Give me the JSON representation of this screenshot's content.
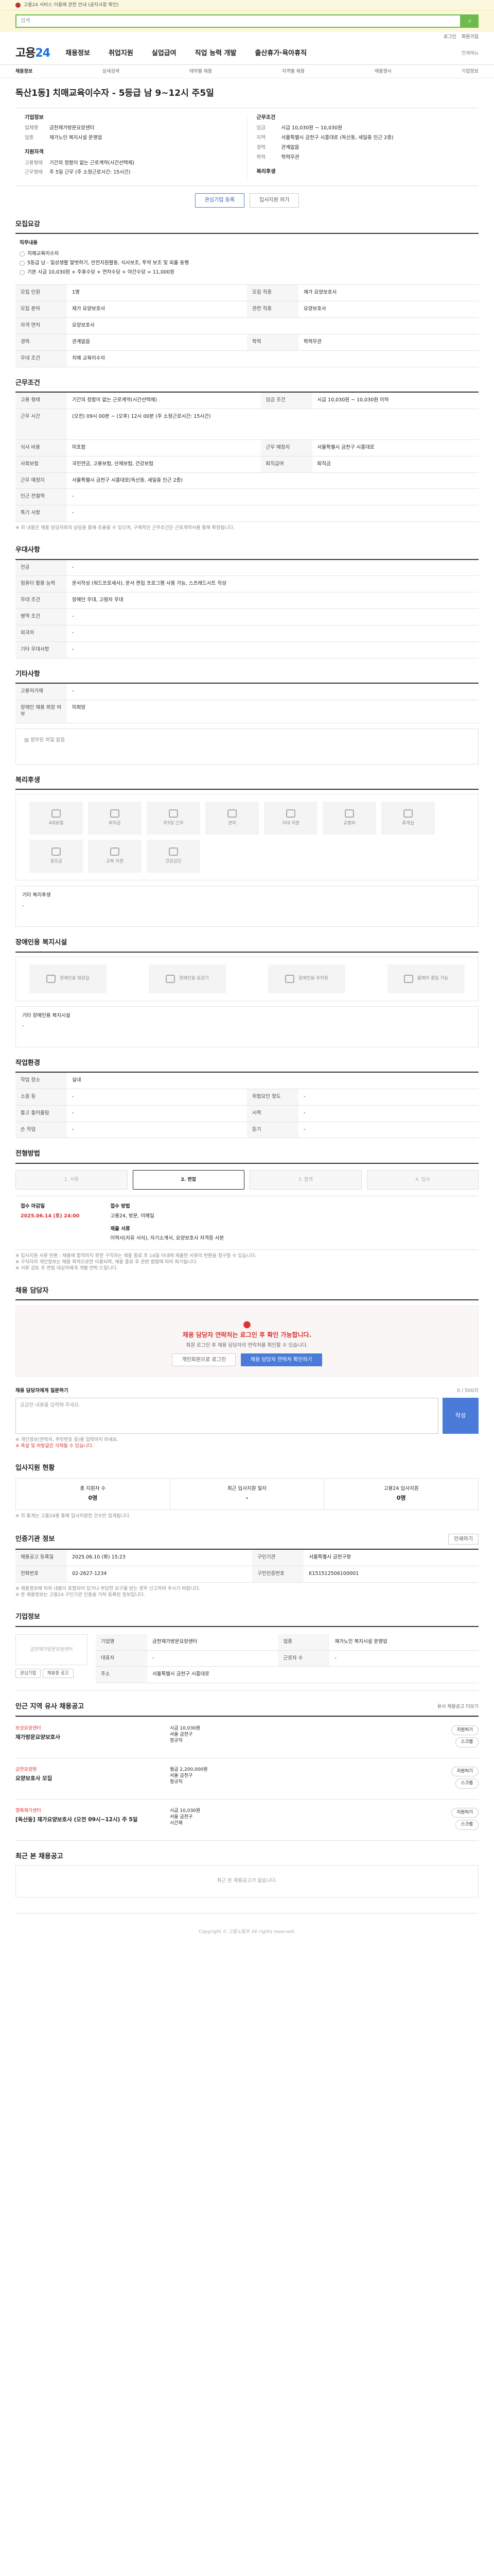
{
  "topbar": {
    "notice": "고용24 서비스 이용에 관한 안내 (공지사항 확인)"
  },
  "search": {
    "placeholder": "검색"
  },
  "util": {
    "login": "로그인",
    "join": "회원가입"
  },
  "gnb": {
    "logo_a": "고용",
    "logo_b": "24",
    "menus": [
      "채용정보",
      "취업지원",
      "실업급여",
      "직업 능력 개발",
      "출산휴가·육아휴직"
    ],
    "right": "전체메뉴"
  },
  "subnav": [
    "채용정보",
    "상세검색",
    "테마별 채용",
    "지역별 채용",
    "채용행사",
    "기업정보"
  ],
  "job": {
    "title": "독산1동] 치매교육이수자 - 5등급 남 9~12시 주5일",
    "company_h": "기업정보",
    "company_rows": [
      {
        "k": "업체명",
        "v": "금천재가방문요양센터"
      },
      {
        "k": "업종",
        "v": "재가노인 복지시설 운영업"
      }
    ],
    "cond_h": "근무조건",
    "cond_rows": [
      {
        "k": "임금",
        "v": "시급 10,030원 ~ 10,030원"
      },
      {
        "k": "지역",
        "v": "서울특별시 금천구 시흥대로 (독산동, 세일중 인근 2층)"
      },
      {
        "k": "경력",
        "v": "관계없음"
      },
      {
        "k": "학력",
        "v": "학력무관"
      }
    ],
    "qual_h": "지원자격",
    "qual_rows": [
      {
        "k": "고용형태",
        "v": "기간의 정함이 없는 근로계약(시간선택제)"
      },
      {
        "k": "근무형태",
        "v": "주 5일 근무 (주 소정근로시간: 15시간)"
      }
    ],
    "welfare_h": "복리후생",
    "btn_apply": "입사지원 하기",
    "btn_interest": "관심기업 등록",
    "btn_scrap": "스크랩"
  },
  "recruit": {
    "h": "모집요강",
    "sub": "직무내용",
    "lines": [
      "치매교육이수자",
      "5등급 남 - 일상생활 말벗하기, 안전지원활동, 식사보조, 투약 보조 및 외출 동행",
      "기본 시급 10,030원 + 주휴수당 + 연차수당 + 야간수당 = 11,000원"
    ],
    "rows": [
      {
        "k": "모집 인원",
        "v": "1명",
        "k2": "모집 직종",
        "v2": "재가 요양보호사"
      },
      {
        "k": "모집 분야",
        "v": "재가 요양보호사",
        "k2": "관련 직종",
        "v2": "요양보호사"
      },
      {
        "k": "자격 면허",
        "v": "요양보호사",
        "k2": "",
        "v2": ""
      },
      {
        "k": "경력",
        "v": "관계없음",
        "k2": "학력",
        "v2": "학력무관"
      },
      {
        "k": "우대 조건",
        "v": "치매 교육이수자",
        "k2": "",
        "v2": ""
      }
    ]
  },
  "work": {
    "h": "근무조건",
    "rows": [
      {
        "k": "고용 형태",
        "v": "기간의 정함이 없는 근로계약(시간선택제)",
        "k2": "임금 조건",
        "v2": "시급 10,030원 ~ 10,030원 이하"
      },
      {
        "k": "근무 시간",
        "v": "(오전) 09시 00분 ~ (오후) 12시 00분 (주 소정근로시간: 15시간)",
        "k2": "",
        "v2": ""
      },
      {
        "k": "식사 비용",
        "v": "미포함",
        "k2": "근무 예정지",
        "v2": "서울특별시 금천구 시흥대로"
      },
      {
        "k": "사회보험",
        "v": "국민연금, 고용보험, 산재보험, 건강보험",
        "k2": "퇴직급여",
        "v2": "퇴직금"
      },
      {
        "k": "근무 예정지",
        "v": "서울특별시 금천구 시흥대로(독산동, 세일중 인근 2층)",
        "k2": "",
        "v2": ""
      },
      {
        "k": "인근 전철역",
        "v": "-",
        "k2": "",
        "v2": ""
      },
      {
        "k": "특기 사항",
        "v": "-",
        "k2": "",
        "v2": ""
      }
    ],
    "note": "※ 위 내용은 채용 담당자와의 상담을 통해 조율될 수 있으며, 구체적인 근무조건은 근로계약서를 통해 확정됩니다."
  },
  "pref": {
    "h": "우대사항",
    "rows": [
      {
        "k": "전공",
        "v": "-"
      },
      {
        "k": "컴퓨터 활용 능력",
        "v": "문서작성 (워드프로세서), 문서 편집 프로그램 사용 가능, 스프레드시트 작성"
      },
      {
        "k": "우대 조건",
        "v": "장애인 우대, 고령자 우대"
      },
      {
        "k": "병역 조건",
        "v": "-"
      },
      {
        "k": "외국어",
        "v": "-"
      },
      {
        "k": "기타 우대사항",
        "v": "-"
      }
    ]
  },
  "other": {
    "h": "기타사항",
    "rows": [
      {
        "k": "고용허가제",
        "v": "-"
      },
      {
        "k": "장애인 채용 희망 여부",
        "v": "미희망"
      }
    ],
    "attach": "첨부된 파일 없음"
  },
  "benefits": {
    "h": "복리후생",
    "items": [
      "4대보험",
      "퇴직금",
      "주5일 근무",
      "연차",
      "식대 지원",
      "교통비",
      "휴게실",
      "경조금",
      "교육 지원",
      "건강검진"
    ],
    "etc_h": "기타 복리후생",
    "etc": "-"
  },
  "disabled": {
    "h": "장애인용 복지시설",
    "items": [
      "장애인용 화장실",
      "장애인용 승강기",
      "장애인용 주차장",
      "휠체어 출입 가능"
    ],
    "etc_h": "기타 장애인용 복지시설",
    "etc": "-"
  },
  "env": {
    "h": "작업환경",
    "rows": [
      {
        "k": "작업 장소",
        "v": "실내",
        "k2": "",
        "v2": ""
      },
      {
        "k": "소음 등",
        "v": "-",
        "k2": "위험요인 정도",
        "v2": "-"
      },
      {
        "k": "들고 들어올림",
        "v": "-",
        "k2": "시력",
        "v2": "-"
      },
      {
        "k": "손 작업",
        "v": "-",
        "k2": "듣기",
        "v2": "-"
      }
    ]
  },
  "select": {
    "h": "전형방법",
    "steps": [
      "1. 서류",
      "2. 면접",
      "3. 합격",
      "4. 입사"
    ],
    "rows": [
      {
        "k": "접수 마감일",
        "v": "2025.06.14 (토) 24:00"
      },
      {
        "k": "접수 방법",
        "v": "고용24, 방문, 이메일"
      },
      {
        "k": "제출 서류",
        "v": "이력서(자유 서식), 자기소개서, 요양보호사 자격증 사본"
      }
    ],
    "notes": [
      "※ 입사지원 서류 반환 : 채용에 합격하지 못한 구직자는 채용 종료 후 14일 이내에 제출한 서류의 반환을 청구할 수 있습니다.",
      "※ 구직자의 개인정보는 채용 목적으로만 이용되며, 채용 종료 후 관련 법령에 따라 파기됩니다.",
      "※ 서류 검토 후 면접 대상자에게 개별 연락 드립니다."
    ]
  },
  "contact": {
    "h": "채용 담당자",
    "big": "채용 담당자 연락처는 로그인 후 확인 가능합니다.",
    "desc": "회원 로그인 후 채용 담당자의 연락처를 확인할 수 있습니다.",
    "btn1": "개인회원으로 로그인",
    "btn2": "채용 담당자 연락처 확인하기"
  },
  "qna": {
    "h": "채용 담당자에게 질문하기",
    "count": "0 / 500자",
    "placeholder": "궁금한 내용을 입력해 주세요.",
    "btn": "작성",
    "notes": [
      "※ 개인정보(연락처, 주민번호 등)를 입력하지 마세요.",
      "※ 욕설 및 비방글은 삭제될 수 있습니다."
    ]
  },
  "status": {
    "h": "입사지원 현황",
    "items": [
      {
        "k": "총 지원자 수",
        "v": "0명"
      },
      {
        "k": "최근 입사지원 일자",
        "v": "-"
      },
      {
        "k": "고용24 입사지원",
        "v": "0명"
      }
    ],
    "note": "※ 위 통계는 고용24를 통해 입사지원한 건수만 집계됩니다."
  },
  "info": {
    "h": "인증기관 정보",
    "btn": "인쇄하기",
    "rows": [
      {
        "k": "채용공고 등록일",
        "v": "2025.06.10 (화) 15:23",
        "k2": "구인기관",
        "v2": "서울특별시 금천구청"
      },
      {
        "k": "전화번호",
        "v": "02-2627-1234",
        "k2": "구인인증번호",
        "v2": "K151512506100001"
      }
    ],
    "notes": [
      "※ 채용정보에 허위 내용이 포함되어 있거나 부당한 요구를 받는 경우 신고하여 주시기 바랍니다.",
      "※ 본 채용정보는 고용24 구인기관 인증을 거쳐 등록된 정보입니다."
    ]
  },
  "company": {
    "h": "기업정보",
    "name": "금천재가방문요양센터",
    "rows": [
      {
        "k": "기업명",
        "v": "금천재가방문요양센터",
        "k2": "업종",
        "v2": "재가노인 복지시설 운영업"
      },
      {
        "k": "대표자",
        "v": "-",
        "k2": "근로자 수",
        "v2": "-"
      },
      {
        "k": "주소",
        "v": "서울특별시 금천구 시흥대로",
        "k2": "",
        "v2": ""
      }
    ],
    "btn1": "관심기업",
    "btn2": "채용중 공고"
  },
  "related": {
    "h": "인근 지역 유사 채용공고",
    "link": "유사 채용공고 더보기",
    "jobs": [
      {
        "co": "보성요양센터",
        "title": "재가방문요양보호사",
        "pay": "시급 10,030원",
        "loc": "서울 금천구",
        "type": "정규직",
        "apply": "지원하기",
        "scrap": "스크랩"
      },
      {
        "co": "금천요양원",
        "title": "요양보호사 모집",
        "pay": "월급 2,200,000원",
        "loc": "서울 금천구",
        "type": "정규직",
        "apply": "지원하기",
        "scrap": "스크랩"
      },
      {
        "co": "행복재가센터",
        "title": "[독산동] 재가요양보호사 (오전 09시~12시) 주 5일",
        "pay": "시급 10,030원",
        "loc": "서울 금천구",
        "type": "시간제",
        "apply": "지원하기",
        "scrap": "스크랩"
      }
    ]
  },
  "recent": {
    "h": "최근 본 채용공고",
    "empty": "최근 본 채용공고가 없습니다."
  },
  "footer": {
    "text": "Copyright © 고용노동부 All rights reserved."
  }
}
